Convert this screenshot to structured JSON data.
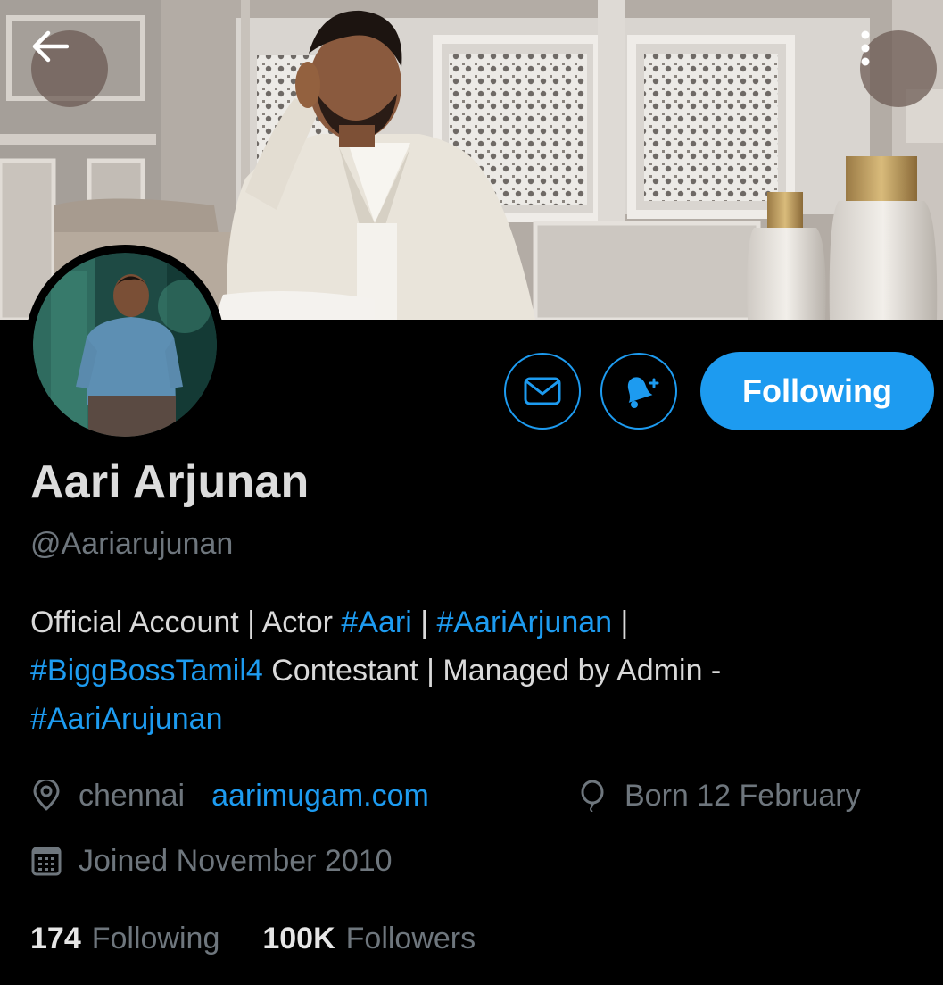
{
  "header": {
    "back_icon": "arrow-left-icon",
    "more_icon": "vertical-ellipsis-icon"
  },
  "actions": {
    "message_icon": "envelope-icon",
    "notify_icon": "bell-plus-icon",
    "follow_label": "Following",
    "accent_color": "#1d9bf0"
  },
  "profile": {
    "display_name": "Aari Arjunan",
    "handle": "@Aariarujunan",
    "bio": {
      "line1": {
        "t1": "Official Account | Actor ",
        "tag1": "#Aari",
        "t2": " | ",
        "tag2": "#AariArjunan",
        "t3": " |"
      },
      "line2": {
        "tag1": "#BiggBossTamil4",
        "t1": " Contestant | Managed by Admin -"
      },
      "line3": {
        "tag1": "#AariArujunan"
      }
    },
    "location": "chennai",
    "location_icon": "location-pin-icon",
    "website": "aarimugam.com",
    "birthday": "Born 12 February",
    "birthday_icon": "balloon-icon",
    "joined": "Joined November 2010",
    "joined_icon": "calendar-icon"
  },
  "stats": {
    "following_count": "174",
    "following_label": "Following",
    "followers_count": "100K",
    "followers_label": "Followers"
  }
}
